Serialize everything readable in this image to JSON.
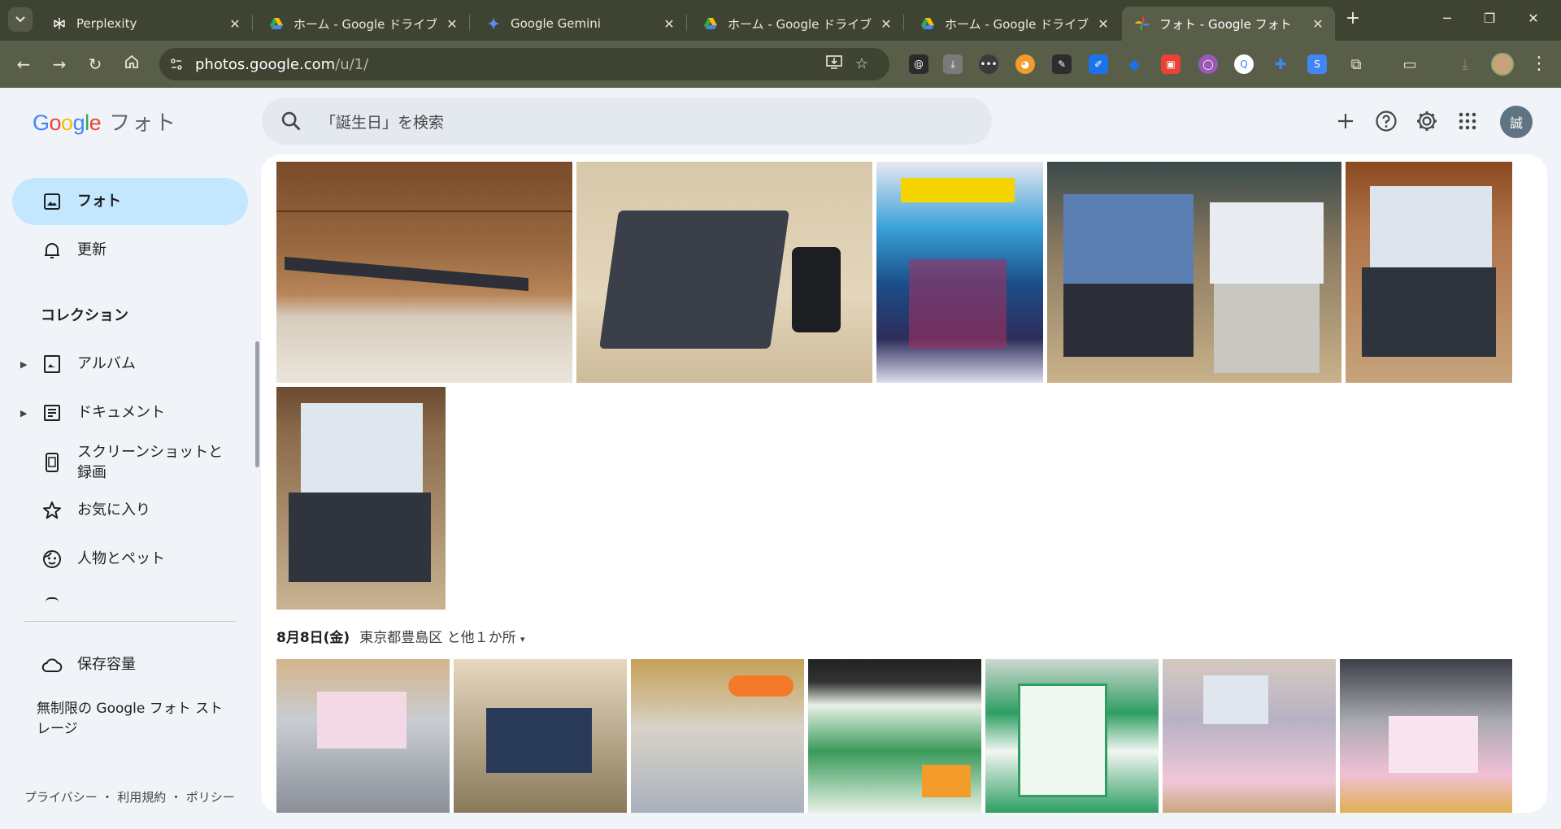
{
  "browser": {
    "tabs": [
      {
        "title": "Perplexity",
        "icon": "perplexity-icon"
      },
      {
        "title": "ホーム - Google ドライブ",
        "icon": "google-drive-icon"
      },
      {
        "title": "Google Gemini",
        "icon": "gemini-icon"
      },
      {
        "title": "ホーム - Google ドライブ",
        "icon": "google-drive-icon"
      },
      {
        "title": "ホーム - Google ドライブ",
        "icon": "google-drive-icon"
      },
      {
        "title": "フォト - Google フォト",
        "icon": "google-photos-icon",
        "active": true
      }
    ],
    "url_host": "photos.google.com",
    "url_path": "/u/1/",
    "extension_colors": [
      "#2b2b2b",
      "#7a7a7a",
      "#3a3a3a",
      "#f29b2d",
      "#2d2d2d",
      "#1a73e8",
      "#1a73e8",
      "#ea4335",
      "#9b59b6",
      "#4285f4",
      "#4285f4",
      "#4285f4"
    ]
  },
  "app": {
    "logo_letters": [
      "G",
      "o",
      "o",
      "g",
      "l",
      "e"
    ],
    "product_name": "フォト",
    "search_placeholder": "「誕生日」を検索",
    "avatar_initial": "誠"
  },
  "sidebar": {
    "photos": "フォト",
    "updates": "更新",
    "collections_title": "コレクション",
    "albums": "アルバム",
    "documents": "ドキュメント",
    "screenshots": "スクリーンショットと録画",
    "favorites": "お気に入り",
    "people_pets": "人物とペット",
    "storage": "保存容量",
    "unlimited_storage": "無制限の Google フォト ストレージ",
    "footer": "プライバシー ・ 利用規約 ・ ポリシー"
  },
  "main": {
    "date": "8月8日(金)",
    "location": "東京都豊島区 と他１か所"
  },
  "colors": {
    "accent": "#c2e7ff",
    "surface": "#f0f4f9",
    "browser_frame": "#3f4432"
  }
}
